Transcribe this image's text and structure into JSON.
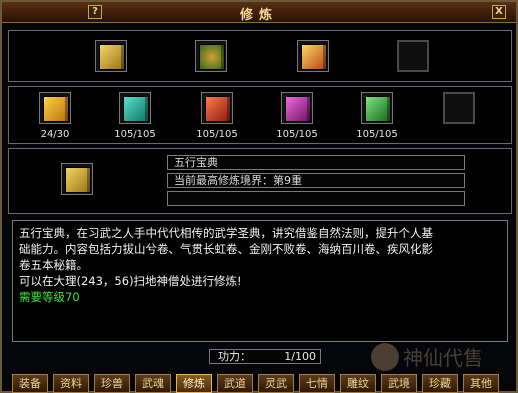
{
  "window": {
    "title": "修炼",
    "help_label": "?",
    "close_label": "X"
  },
  "row1_items": [
    {
      "icon": "book-gold-icon",
      "color": "#c0a028"
    },
    {
      "icon": "item-green-icon",
      "color": "#3b8f2a"
    },
    {
      "icon": "book-fire-icon",
      "color": "#d37a1a"
    },
    {
      "icon": "empty-slot-icon",
      "color": "#111111"
    }
  ],
  "skill_books": [
    {
      "icon": "book-yellow-icon",
      "count": "24/30",
      "color": "#d99a13"
    },
    {
      "icon": "book-teal-icon",
      "count": "105/105",
      "color": "#19a69a"
    },
    {
      "icon": "book-red-icon",
      "count": "105/105",
      "color": "#c53418"
    },
    {
      "icon": "book-purple-icon",
      "count": "105/105",
      "color": "#b12a9e"
    },
    {
      "icon": "book-green-icon",
      "count": "105/105",
      "color": "#2fa33c"
    }
  ],
  "selected": {
    "name": "五行宝典",
    "realm": "当前最高修炼境界：第9重",
    "extra": ""
  },
  "description": {
    "line1": "五行宝典，在习武之人手中代代相传的武学圣典，讲究借鉴自然法则，提升个人基",
    "line2": "础能力。内容包括力拔山兮卷、气贯长虹卷、金刚不败卷、海纳百川卷、疾风化影",
    "line3": "卷五本秘籍。",
    "line4": "可以在大理(243，56)扫地神僧处进行修炼!",
    "line5": "需要等级70"
  },
  "power": {
    "label": "功力：",
    "value": "1/100"
  },
  "tabs": [
    "装备",
    "资料",
    "珍兽",
    "武魂",
    "修炼",
    "武道",
    "灵武",
    "七情",
    "雕纹",
    "武境",
    "珍藏",
    "其他"
  ],
  "active_tab": "修炼",
  "watermark": "神仙代售"
}
